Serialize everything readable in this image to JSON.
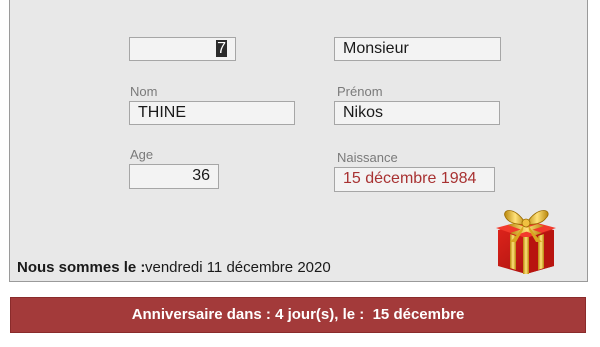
{
  "form": {
    "id_value": "7",
    "civilite_value": "Monsieur",
    "nom_label": "Nom",
    "nom_value": "THINE",
    "prenom_label": "Prénom",
    "prenom_value": "Nikos",
    "age_label": "Age",
    "age_value": "36",
    "naissance_label": "Naissance",
    "naissance_value": "15 décembre 1984"
  },
  "status": {
    "label": "Nous sommes le :",
    "value": "vendredi 11 décembre 2020"
  },
  "banner": {
    "text": "Anniversaire dans : 4 jour(s), le :  15 décembre"
  },
  "colors": {
    "banner_bg": "#a33a3a",
    "accent_text": "#a83232",
    "panel_bg": "#e8e8e8"
  },
  "icons": {
    "gift": "gift-icon"
  }
}
